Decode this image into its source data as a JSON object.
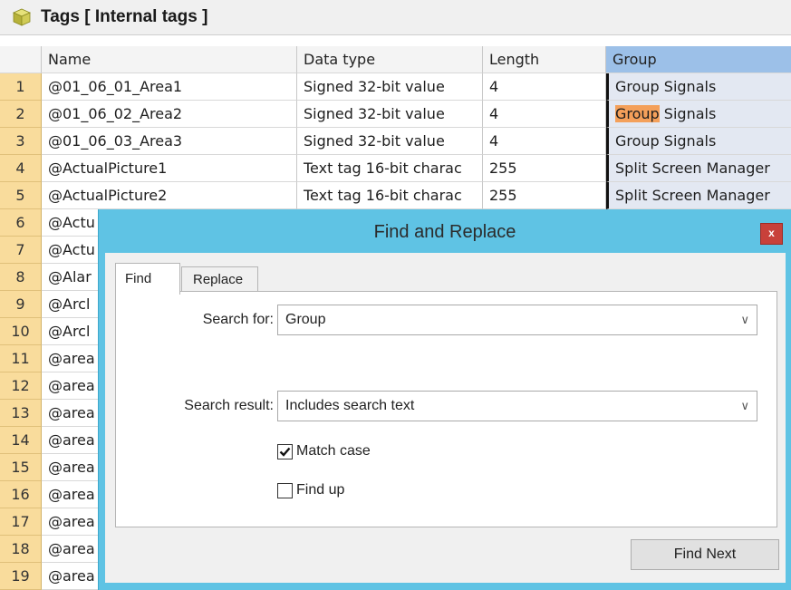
{
  "window": {
    "title": "Tags [ Internal tags ]"
  },
  "grid": {
    "columns": [
      "Name",
      "Data type",
      "Length",
      "Group"
    ],
    "rows": [
      {
        "num": "1",
        "name": "@01_06_01_Area1",
        "type": "Signed 32-bit value",
        "length": "4",
        "group": "Group Signals"
      },
      {
        "num": "2",
        "name": "@01_06_02_Area2",
        "type": "Signed 32-bit value",
        "length": "4",
        "group_pre": "Group",
        "group_post": " Signals"
      },
      {
        "num": "3",
        "name": "@01_06_03_Area3",
        "type": "Signed 32-bit value",
        "length": "4",
        "group": "Group Signals"
      },
      {
        "num": "4",
        "name": "@ActualPicture1",
        "type": "Text tag 16-bit charac",
        "length": "255",
        "group": "Split Screen Manager"
      },
      {
        "num": "5",
        "name": "@ActualPicture2",
        "type": "Text tag 16-bit charac",
        "length": "255",
        "group": "Split Screen Manager"
      },
      {
        "num": "6",
        "name": "@Actu"
      },
      {
        "num": "7",
        "name": "@Actu"
      },
      {
        "num": "8",
        "name": "@Alar"
      },
      {
        "num": "9",
        "name": "@Arcl"
      },
      {
        "num": "10",
        "name": "@Arcl"
      },
      {
        "num": "11",
        "name": "@area"
      },
      {
        "num": "12",
        "name": "@area"
      },
      {
        "num": "13",
        "name": "@area"
      },
      {
        "num": "14",
        "name": "@area"
      },
      {
        "num": "15",
        "name": "@area"
      },
      {
        "num": "16",
        "name": "@area"
      },
      {
        "num": "17",
        "name": "@area"
      },
      {
        "num": "18",
        "name": "@area"
      },
      {
        "num": "19",
        "name": "@area"
      }
    ]
  },
  "dialog": {
    "title": "Find and Replace",
    "close_label": "x",
    "tabs": [
      "Find",
      "Replace"
    ],
    "search_for_label": "Search for:",
    "search_for_value": "Group",
    "search_result_label": "Search result:",
    "search_result_value": "Includes search text",
    "match_case_label": "Match case",
    "match_case_checked": true,
    "find_up_label": "Find up",
    "find_up_checked": false,
    "find_next_label": "Find Next"
  },
  "colors": {
    "row_number_bg": "#f9dc9c",
    "group_header_bg": "#9cc0e8",
    "highlight": "#f4a05a",
    "dialog_frame": "#5fc3e4",
    "close_button": "#c8413a"
  },
  "icons": {
    "title": "cube-icon",
    "combo_arrow": "chevron-down-icon",
    "check": "checkmark-icon"
  }
}
